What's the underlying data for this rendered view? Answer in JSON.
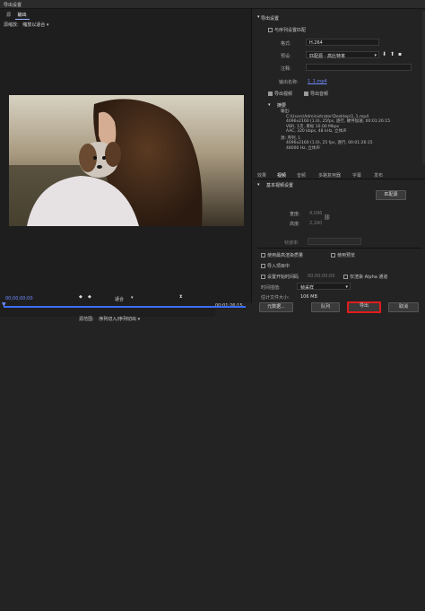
{
  "window": {
    "title": "导出设置"
  },
  "left": {
    "tabs": [
      "源",
      "输出"
    ],
    "source_scaling_label": "源缩放:",
    "source_scaling_value": "缩放以适合",
    "timecode_start": "00;00;00;00",
    "timecode_end": "00;01;26;15",
    "zoom_value": "适合",
    "source_range_label": "源范围:",
    "source_range_value": "序列切入/序列切出"
  },
  "export_settings": {
    "section_title": "导出设置",
    "match_sequence_label": "与序列设置匹配",
    "format_label": "格式:",
    "format_value": "H.264",
    "preset_label": "预设:",
    "preset_value": "匹配源 - 高比特率",
    "comments_label": "注释:",
    "output_name_label": "输出名称:",
    "output_name_value": "1_1.mp4",
    "export_video_label": "导出视频",
    "export_audio_label": "导出音频"
  },
  "summary": {
    "title": "摘要",
    "output_label": "输出:",
    "output_lines": [
      "C:\\Users\\Administrator\\Desktop\\1_1.mp4",
      "4096x2160 (1.0), 25fps, 逐行, 硬件加速, 00:01:26:15",
      "VBR, 1次, 目标 10.00 Mbps",
      "AAC, 320 kbps, 48 kHz, 立体声"
    ],
    "source_label": "源: 序列, 1",
    "source_lines": [
      "4096x2160 (1.0), 25 fps, 逐行, 00:01:26:15",
      "48000 Hz, 立体声"
    ]
  },
  "tabs2": [
    "效果",
    "视频",
    "音频",
    "多路复用器",
    "字幕",
    "发布"
  ],
  "basic_video": {
    "section_title": "基本视频设置",
    "match_source_button": "匹配源",
    "width_label": "宽度:",
    "width_value": "4,096",
    "height_label": "高度:",
    "height_value": "2,160",
    "frame_rate_label": "帧速率:"
  },
  "options": {
    "max_render_quality": "使用最高渲染质量",
    "use_previews": "使用预览",
    "import_into_project": "导入项目中",
    "set_start_timecode": "设置开始时间码",
    "start_timecode_value": "00;00;00;00",
    "render_alpha_only": "仅渲染 Alpha 通道",
    "interpolation_label": "时间插值:",
    "interpolation_value": "帧采样",
    "file_size_label": "估计文件大小:",
    "file_size_value": "106 MB"
  },
  "buttons": {
    "metadata": "元数据...",
    "queue": "队列",
    "export": "导出",
    "cancel": "取消"
  },
  "colors": {
    "accent": "#3b6eff",
    "highlight": "#e21c1c"
  }
}
